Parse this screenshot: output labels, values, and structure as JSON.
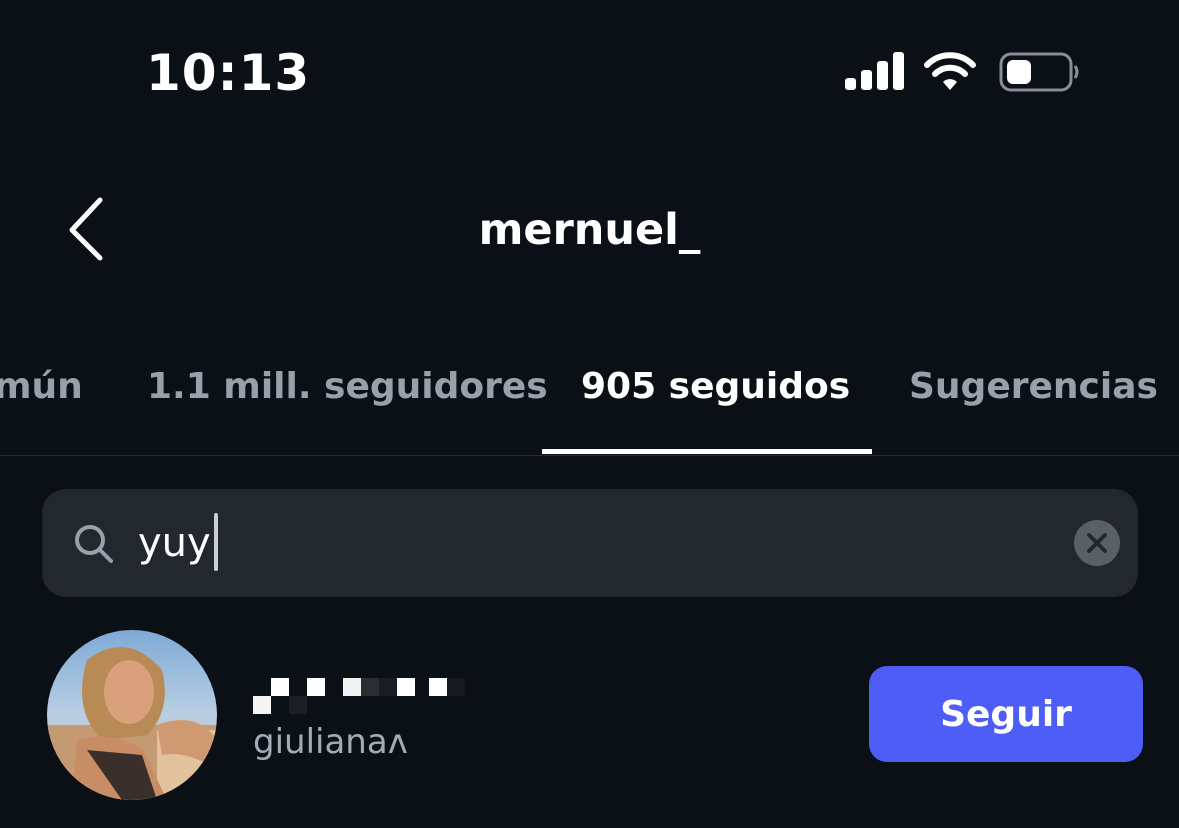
{
  "status_bar": {
    "time": "10:13",
    "icons": [
      "cellular-signal-icon",
      "wifi-icon",
      "battery-icon"
    ]
  },
  "header": {
    "title": "mernuel_",
    "back_icon": "chevron-left-icon"
  },
  "tabs": [
    {
      "label": "mún",
      "active": false
    },
    {
      "label": "1.1 mill. seguidores",
      "active": false
    },
    {
      "label": "905 seguidos",
      "active": true
    },
    {
      "label": "Sugerencias",
      "active": false
    }
  ],
  "search": {
    "value": "yuy",
    "icon": "search-icon",
    "clear_icon": "close-circle-icon"
  },
  "results": [
    {
      "username_redacted": true,
      "display_name": "giulianaʌ",
      "follow_label": "Seguir"
    }
  ],
  "colors": {
    "background": "#0b0f16",
    "accent": "#4d5df5",
    "muted_text": "#9aa0ab",
    "search_bg": "#23272e"
  }
}
